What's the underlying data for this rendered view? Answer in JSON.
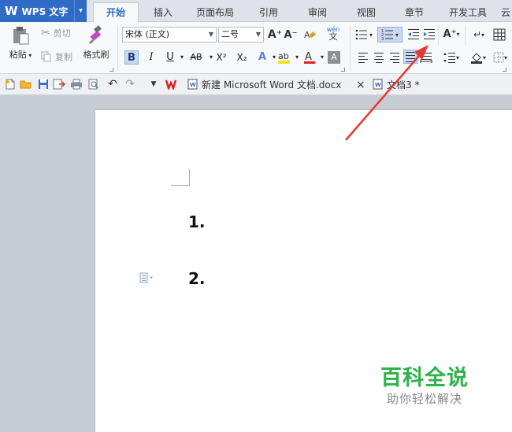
{
  "app": {
    "logo": "W",
    "name": "WPS 文字",
    "menu_arrow": "▾"
  },
  "tabs": [
    {
      "label": "开始",
      "active": true
    },
    {
      "label": "插入"
    },
    {
      "label": "页面布局"
    },
    {
      "label": "引用"
    },
    {
      "label": "审阅"
    },
    {
      "label": "视图"
    },
    {
      "label": "章节"
    },
    {
      "label": "开发工具"
    },
    {
      "label": "云"
    }
  ],
  "ribbon": {
    "paste_label": "粘贴",
    "cut_label": "剪切",
    "copy_label": "复制",
    "format_painter_label": "格式刷",
    "font_name": "宋体 (正文)",
    "font_size": "二号",
    "grow_font": "A⁺",
    "shrink_font": "A⁻",
    "bold": "B",
    "italic": "I",
    "underline": "U",
    "strike": "AB",
    "superscript": "X²",
    "subscript": "X₂",
    "wen_label": "wén\n文"
  },
  "quickbar": {
    "doc_tab_1": "新建 Microsoft Word 文档.docx",
    "close_symbol": "×",
    "doc_tab_2": "文档3 *"
  },
  "document": {
    "list_item_1": "1.",
    "list_item_2": "2."
  },
  "watermark": {
    "title": "百科全说",
    "subtitle": "助你轻松解决"
  },
  "colors": {
    "accent": "#2f6bc7",
    "arrow": "#e53935",
    "watermark_green": "#2db24a"
  }
}
